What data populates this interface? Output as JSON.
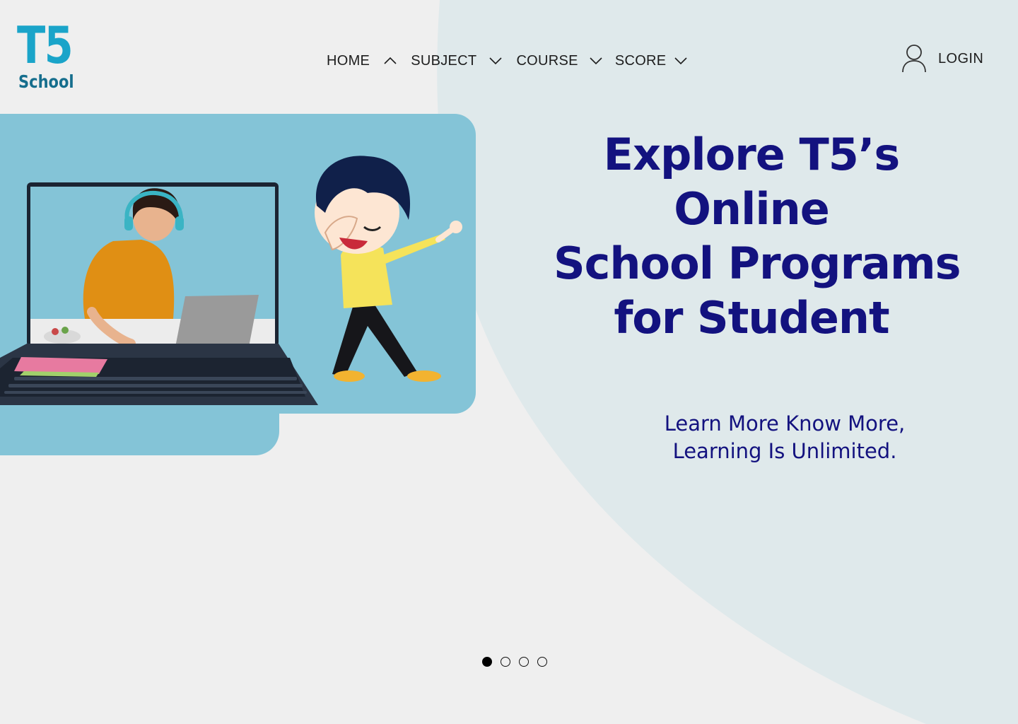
{
  "brand": {
    "mark": "T5",
    "name": "School"
  },
  "nav": {
    "items": [
      {
        "label": "HOME",
        "chevron": "up"
      },
      {
        "label": "SUBJECT",
        "chevron": "down"
      },
      {
        "label": "COURSE",
        "chevron": "down"
      },
      {
        "label": "SCORE",
        "chevron": "down"
      }
    ],
    "login_label": "LOGIN",
    "login_icon": "user-icon"
  },
  "hero": {
    "headline_lines": [
      "Explore T5’s",
      "Online",
      "School Programs",
      "for Student"
    ],
    "tagline_lines": [
      "Learn More Know More,",
      "Learning Is Unlimited."
    ],
    "illustration": "student-studying-in-laptop-with-dabbing-cartoon-boy"
  },
  "carousel": {
    "slide_count": 4,
    "active_index": 0
  },
  "colors": {
    "page_background": "#efefef",
    "curve_background": "#dfe9eb",
    "panel": "#84c4d7",
    "headline": "#13127f",
    "logo_primary": "#1aa4c9",
    "logo_secondary": "#166e8d"
  }
}
